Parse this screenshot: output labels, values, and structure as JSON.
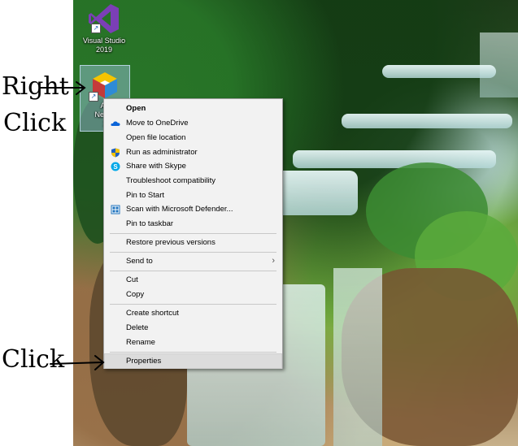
{
  "desktop": {
    "icons": [
      {
        "label_line1": "Visual Studio",
        "label_line2": "2019",
        "icon": "visual-studio-icon"
      },
      {
        "label_line1": "Ap",
        "label_line2": "NetBe",
        "label_line3": "1",
        "icon": "netbeans-icon"
      }
    ]
  },
  "context_menu": {
    "items": [
      {
        "label": "Open",
        "bold": true
      },
      {
        "label": "Move to OneDrive",
        "icon": "onedrive-icon"
      },
      {
        "label": "Open file location"
      },
      {
        "label": "Run as administrator",
        "icon": "shield-icon"
      },
      {
        "label": "Share with Skype",
        "icon": "skype-icon"
      },
      {
        "label": "Troubleshoot compatibility"
      },
      {
        "label": "Pin to Start"
      },
      {
        "label": "Scan with Microsoft Defender...",
        "icon": "defender-icon"
      },
      {
        "label": "Pin to taskbar"
      },
      {
        "label": "Restore previous versions"
      },
      {
        "label": "Send to",
        "submenu_arrow": "›"
      },
      {
        "label": "Cut"
      },
      {
        "label": "Copy"
      },
      {
        "label": "Create shortcut"
      },
      {
        "label": "Delete"
      },
      {
        "label": "Rename"
      },
      {
        "label": "Properties",
        "highlighted": true
      }
    ]
  },
  "annotations": {
    "right_click_line1": "Right",
    "right_click_line2": "Click",
    "click": "Click"
  },
  "colors": {
    "menu_bg": "#f2f2f2",
    "menu_highlight": "#dcdcdc",
    "onedrive_blue": "#0a64d8",
    "skype_blue": "#00a8e8",
    "vs_purple": "#7b3fb6"
  }
}
